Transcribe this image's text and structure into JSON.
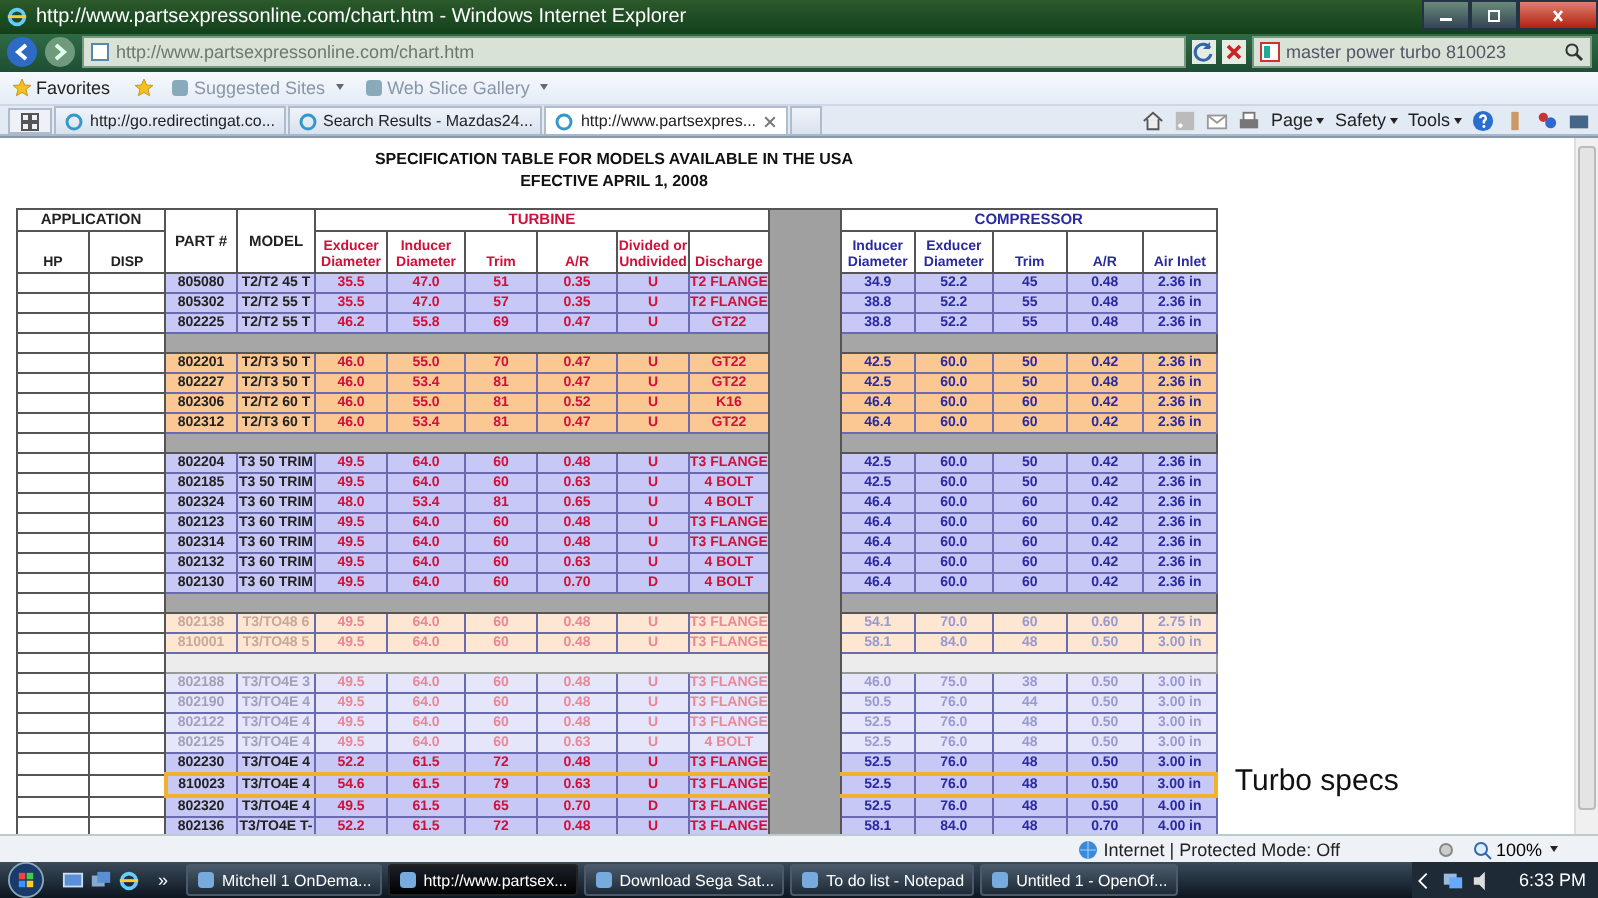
{
  "window": {
    "title": "http://www.partsexpressonline.com/chart.htm - Windows Internet Explorer"
  },
  "address_bar": {
    "url": "http://www.partsexpressonline.com/chart.htm"
  },
  "search": {
    "value": "master power turbo 810023"
  },
  "favorites_bar": {
    "label": "Favorites",
    "items": [
      "Suggested Sites",
      "Web Slice Gallery"
    ]
  },
  "tabs": [
    {
      "label": "http://go.redirectingat.co...",
      "selected": false
    },
    {
      "label": "Search Results - Mazdas24...",
      "selected": false
    },
    {
      "label": "http://www.partsexpres...",
      "selected": true
    }
  ],
  "command_bar": [
    "Page",
    "Safety",
    "Tools"
  ],
  "page": {
    "title": "SPECIFICATION TABLE FOR MODELS AVAILABLE IN THE USA",
    "subtitle": "EFECTIVE APRIL 1, 2008"
  },
  "table": {
    "application": "APPLICATION",
    "hp": "HP",
    "disp": "DISP",
    "part": "PART #",
    "model": "MODEL",
    "turbine": "TURBINE",
    "compressor": "COMPRESSOR",
    "turbine_columns": [
      "Exducer Diameter",
      "Inducer Diameter",
      "Trim",
      "A/R",
      "Divided or Undivided",
      "Discharge"
    ],
    "compressor_columns": [
      "Inducer Diameter",
      "Exducer Diameter",
      "Trim",
      "A/R",
      "Air Inlet"
    ],
    "rows": [
      {
        "kind": "blue",
        "faded": false,
        "highlighted": false,
        "part": "805080",
        "model": "T2/T2 45 T",
        "turbine": [
          "35.5",
          "47.0",
          "51",
          "0.35",
          "U",
          "T2 FLANGE"
        ],
        "compressor": [
          "34.9",
          "52.2",
          "45",
          "0.48",
          "2.36 in"
        ]
      },
      {
        "kind": "blue",
        "faded": false,
        "highlighted": false,
        "part": "805302",
        "model": "T2/T2 55 T",
        "turbine": [
          "35.5",
          "47.0",
          "57",
          "0.35",
          "U",
          "T2 FLANGE"
        ],
        "compressor": [
          "38.8",
          "52.2",
          "55",
          "0.48",
          "2.36 in"
        ]
      },
      {
        "kind": "blue",
        "faded": false,
        "highlighted": false,
        "part": "802225",
        "model": "T2/T2 55 T",
        "turbine": [
          "46.2",
          "55.8",
          "69",
          "0.47",
          "U",
          "GT22"
        ],
        "compressor": [
          "38.8",
          "52.2",
          "55",
          "0.48",
          "2.36 in"
        ]
      },
      {
        "kind": "separator"
      },
      {
        "kind": "orange",
        "faded": false,
        "highlighted": false,
        "part": "802201",
        "model": "T2/T3 50 T",
        "turbine": [
          "46.0",
          "55.0",
          "70",
          "0.47",
          "U",
          "GT22"
        ],
        "compressor": [
          "42.5",
          "60.0",
          "50",
          "0.42",
          "2.36 in"
        ]
      },
      {
        "kind": "orange",
        "faded": false,
        "highlighted": false,
        "part": "802227",
        "model": "T2/T3 50 T",
        "turbine": [
          "46.0",
          "53.4",
          "81",
          "0.47",
          "U",
          "GT22"
        ],
        "compressor": [
          "42.5",
          "60.0",
          "50",
          "0.48",
          "2.36 in"
        ]
      },
      {
        "kind": "orange",
        "faded": false,
        "highlighted": false,
        "part": "802306",
        "model": "T2/T2 60 T",
        "turbine": [
          "46.0",
          "55.0",
          "81",
          "0.52",
          "U",
          "K16"
        ],
        "compressor": [
          "46.4",
          "60.0",
          "60",
          "0.42",
          "2.36 in"
        ]
      },
      {
        "kind": "orange",
        "faded": false,
        "highlighted": false,
        "part": "802312",
        "model": "T2/T3 60 T",
        "turbine": [
          "46.0",
          "53.4",
          "81",
          "0.47",
          "U",
          "GT22"
        ],
        "compressor": [
          "46.4",
          "60.0",
          "60",
          "0.42",
          "2.36 in"
        ]
      },
      {
        "kind": "separator"
      },
      {
        "kind": "blue",
        "faded": false,
        "highlighted": false,
        "part": "802204",
        "model": "T3 50 TRIM",
        "turbine": [
          "49.5",
          "64.0",
          "60",
          "0.48",
          "U",
          "T3 FLANGE"
        ],
        "compressor": [
          "42.5",
          "60.0",
          "50",
          "0.42",
          "2.36 in"
        ]
      },
      {
        "kind": "blue",
        "faded": false,
        "highlighted": false,
        "part": "802185",
        "model": "T3 50 TRIM",
        "turbine": [
          "49.5",
          "64.0",
          "60",
          "0.63",
          "U",
          "4 BOLT"
        ],
        "compressor": [
          "42.5",
          "60.0",
          "50",
          "0.42",
          "2.36 in"
        ]
      },
      {
        "kind": "blue",
        "faded": false,
        "highlighted": false,
        "part": "802324",
        "model": "T3 60 TRIM",
        "turbine": [
          "48.0",
          "53.4",
          "81",
          "0.65",
          "U",
          "4 BOLT"
        ],
        "compressor": [
          "46.4",
          "60.0",
          "60",
          "0.42",
          "2.36 in"
        ]
      },
      {
        "kind": "blue",
        "faded": false,
        "highlighted": false,
        "part": "802123",
        "model": "T3 60 TRIM",
        "turbine": [
          "49.5",
          "64.0",
          "60",
          "0.48",
          "U",
          "T3 FLANGE"
        ],
        "compressor": [
          "46.4",
          "60.0",
          "60",
          "0.42",
          "2.36 in"
        ]
      },
      {
        "kind": "blue",
        "faded": false,
        "highlighted": false,
        "part": "802314",
        "model": "T3 60 TRIM",
        "turbine": [
          "49.5",
          "64.0",
          "60",
          "0.48",
          "U",
          "T3 FLANGE"
        ],
        "compressor": [
          "46.4",
          "60.0",
          "60",
          "0.42",
          "2.36 in"
        ]
      },
      {
        "kind": "blue",
        "faded": false,
        "highlighted": false,
        "part": "802132",
        "model": "T3 60 TRIM",
        "turbine": [
          "49.5",
          "64.0",
          "60",
          "0.63",
          "U",
          "4 BOLT"
        ],
        "compressor": [
          "46.4",
          "60.0",
          "60",
          "0.42",
          "2.36 in"
        ]
      },
      {
        "kind": "blue",
        "faded": false,
        "highlighted": false,
        "part": "802130",
        "model": "T3 60 TRIM",
        "turbine": [
          "49.5",
          "64.0",
          "60",
          "0.70",
          "D",
          "4 BOLT"
        ],
        "compressor": [
          "46.4",
          "60.0",
          "60",
          "0.42",
          "2.36 in"
        ]
      },
      {
        "kind": "separator"
      },
      {
        "kind": "orange",
        "faded": true,
        "highlighted": false,
        "part": "802138",
        "model": "T3/TO48 6",
        "turbine": [
          "49.5",
          "64.0",
          "60",
          "0.48",
          "U",
          "T3 FLANGE"
        ],
        "compressor": [
          "54.1",
          "70.0",
          "60",
          "0.60",
          "2.75 in"
        ]
      },
      {
        "kind": "orange",
        "faded": true,
        "highlighted": false,
        "part": "810001",
        "model": "T3/TO48 5",
        "turbine": [
          "49.5",
          "64.0",
          "60",
          "0.48",
          "U",
          "T3 FLANGE"
        ],
        "compressor": [
          "58.1",
          "84.0",
          "48",
          "0.50",
          "3.00 in"
        ]
      },
      {
        "kind": "blank"
      },
      {
        "kind": "blue",
        "faded": true,
        "highlighted": false,
        "part": "802188",
        "model": "T3/TO4E 3",
        "turbine": [
          "49.5",
          "64.0",
          "60",
          "0.48",
          "U",
          "T3 FLANGE"
        ],
        "compressor": [
          "46.0",
          "75.0",
          "38",
          "0.50",
          "3.00 in"
        ]
      },
      {
        "kind": "blue",
        "faded": true,
        "highlighted": false,
        "part": "802190",
        "model": "T3/TO4E 4",
        "turbine": [
          "49.5",
          "64.0",
          "60",
          "0.48",
          "U",
          "T3 FLANGE"
        ],
        "compressor": [
          "50.5",
          "76.0",
          "44",
          "0.50",
          "3.00 in"
        ]
      },
      {
        "kind": "blue",
        "faded": true,
        "highlighted": false,
        "part": "802122",
        "model": "T3/TO4E 4",
        "turbine": [
          "49.5",
          "64.0",
          "60",
          "0.48",
          "U",
          "T3 FLANGE"
        ],
        "compressor": [
          "52.5",
          "76.0",
          "48",
          "0.50",
          "3.00 in"
        ]
      },
      {
        "kind": "blue",
        "faded": true,
        "highlighted": false,
        "part": "802125",
        "model": "T3/TO4E 4",
        "turbine": [
          "49.5",
          "64.0",
          "60",
          "0.63",
          "U",
          "4 BOLT"
        ],
        "compressor": [
          "52.5",
          "76.0",
          "48",
          "0.50",
          "3.00 in"
        ]
      },
      {
        "kind": "blue",
        "faded": false,
        "highlighted": false,
        "part": "802230",
        "model": "T3/TO4E 4",
        "turbine": [
          "52.2",
          "61.5",
          "72",
          "0.48",
          "U",
          "T3 FLANGE"
        ],
        "compressor": [
          "52.5",
          "76.0",
          "48",
          "0.50",
          "3.00 in"
        ]
      },
      {
        "kind": "blue",
        "faded": false,
        "highlighted": true,
        "callout": "Turbo specs",
        "part": "810023",
        "model": "T3/TO4E 4",
        "turbine": [
          "54.6",
          "61.5",
          "79",
          "0.63",
          "U",
          "T3 FLANGE"
        ],
        "compressor": [
          "52.5",
          "76.0",
          "48",
          "0.50",
          "3.00 in"
        ]
      },
      {
        "kind": "blue",
        "faded": false,
        "highlighted": false,
        "part": "802320",
        "model": "T3/TO4E 4",
        "turbine": [
          "49.5",
          "61.5",
          "65",
          "0.70",
          "D",
          "T3 FLANGE"
        ],
        "compressor": [
          "52.5",
          "76.0",
          "48",
          "0.50",
          "4.00 in"
        ]
      },
      {
        "kind": "blue",
        "faded": false,
        "highlighted": false,
        "part": "802136",
        "model": "T3/TO4E T-",
        "turbine": [
          "52.2",
          "61.5",
          "72",
          "0.48",
          "U",
          "T3 FLANGE"
        ],
        "compressor": [
          "58.1",
          "84.0",
          "48",
          "0.70",
          "4.00 in"
        ]
      }
    ]
  },
  "status_bar": {
    "zone": "Internet | Protected Mode: Off",
    "zoom": "100%"
  },
  "taskbar": {
    "items": [
      {
        "label": "Mitchell 1 OnDema...",
        "selected": false
      },
      {
        "label": "http://www.partsex...",
        "selected": true
      },
      {
        "label": "Download Sega Sat...",
        "selected": false
      },
      {
        "label": "To do list - Notepad",
        "selected": false
      },
      {
        "label": "Untitled 1 - OpenOf...",
        "selected": false
      }
    ],
    "more": "»",
    "clock": "6:33 PM"
  }
}
